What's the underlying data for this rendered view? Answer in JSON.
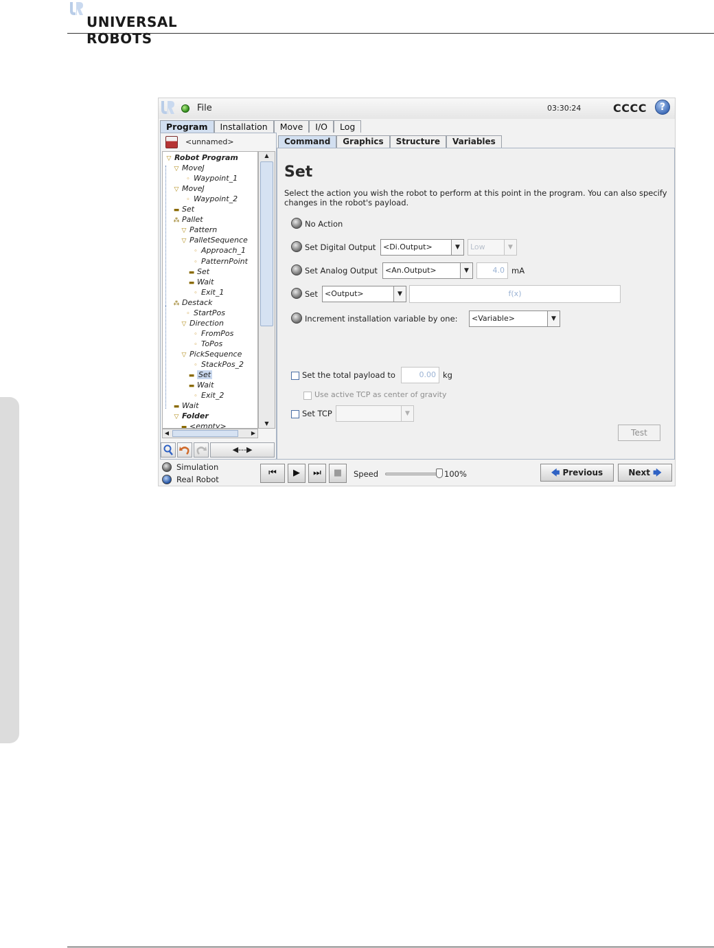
{
  "page": {
    "brand": "UNIVERSAL ROBOTS"
  },
  "titlebar": {
    "file_label": "File",
    "clock": "03:30:24",
    "robot_name": "CCCC",
    "help_glyph": "?"
  },
  "main_tabs": [
    "Program",
    "Installation",
    "Move",
    "I/O",
    "Log"
  ],
  "program": {
    "name": "<unnamed>",
    "tree": [
      {
        "label": "Robot Program",
        "depth": 0,
        "icon": "triangle",
        "bold": true
      },
      {
        "label": "MoveJ",
        "depth": 1,
        "icon": "triangle"
      },
      {
        "label": "Waypoint_1",
        "depth": 2,
        "icon": "waypoint"
      },
      {
        "label": "MoveJ",
        "depth": 1,
        "icon": "triangle"
      },
      {
        "label": "Waypoint_2",
        "depth": 2,
        "icon": "waypoint"
      },
      {
        "label": "Set",
        "depth": 1,
        "icon": "bar"
      },
      {
        "label": "Pallet",
        "depth": 1,
        "icon": "pallet"
      },
      {
        "label": "Pattern",
        "depth": 2,
        "icon": "triangle"
      },
      {
        "label": "PalletSequence",
        "depth": 2,
        "icon": "triangle"
      },
      {
        "label": "Approach_1",
        "depth": 3,
        "icon": "waypoint"
      },
      {
        "label": "PatternPoint",
        "depth": 3,
        "icon": "waypoint"
      },
      {
        "label": "Set",
        "depth": 3,
        "icon": "bar"
      },
      {
        "label": "Wait",
        "depth": 3,
        "icon": "bar"
      },
      {
        "label": "Exit_1",
        "depth": 3,
        "icon": "waypoint"
      },
      {
        "label": "Destack",
        "depth": 1,
        "icon": "pallet"
      },
      {
        "label": "StartPos",
        "depth": 2,
        "icon": "waypoint"
      },
      {
        "label": "Direction",
        "depth": 2,
        "icon": "triangle"
      },
      {
        "label": "FromPos",
        "depth": 3,
        "icon": "waypoint"
      },
      {
        "label": "ToPos",
        "depth": 3,
        "icon": "waypoint"
      },
      {
        "label": "PickSequence",
        "depth": 2,
        "icon": "triangle"
      },
      {
        "label": "StackPos_2",
        "depth": 3,
        "icon": "waypoint"
      },
      {
        "label": "Set",
        "depth": 3,
        "icon": "bar",
        "selected": true
      },
      {
        "label": "Wait",
        "depth": 3,
        "icon": "bar"
      },
      {
        "label": "Exit_2",
        "depth": 3,
        "icon": "waypoint"
      },
      {
        "label": "Wait",
        "depth": 1,
        "icon": "bar"
      },
      {
        "label": "Folder",
        "depth": 1,
        "icon": "triangle",
        "bold": true
      },
      {
        "label": "<empty>",
        "depth": 2,
        "icon": "bar"
      }
    ],
    "tools": {
      "search": "search-icon",
      "undo": "undo-icon",
      "redo": "redo-icon",
      "move_label": "◀---▶"
    }
  },
  "sub_tabs": [
    "Command",
    "Graphics",
    "Structure",
    "Variables"
  ],
  "command": {
    "title": "Set",
    "description": "Select the action you wish the robot to perform at this point in the program. You can also specify changes in the robot's payload.",
    "no_action": "No Action",
    "digital_output_label": "Set Digital Output",
    "digital_output_value": "<Di.Output>",
    "digital_level_value": "Low",
    "analog_output_label": "Set Analog Output",
    "analog_output_value": "<An.Output>",
    "analog_value": "4.0",
    "analog_unit": "mA",
    "set_label": "Set",
    "set_output_value": "<Output>",
    "expression_placeholder": "f(x)",
    "increment_label": "Increment installation variable by one:",
    "variable_value": "<Variable>",
    "payload_label": "Set the total payload to",
    "payload_value": "0.00",
    "payload_unit": "kg",
    "cog_label": "Use active TCP as center of gravity",
    "tcp_label": "Set TCP",
    "test_label": "Test"
  },
  "bottom": {
    "simulation_label": "Simulation",
    "real_robot_label": "Real Robot",
    "speed_label": "Speed",
    "speed_value": "100%",
    "speed_fraction": 1.0,
    "previous_label": "Previous",
    "next_label": "Next"
  },
  "colors": {
    "active_tab": "#d2dff0",
    "accent_blue": "#2f62c4",
    "tree_icon": "#b08b16"
  }
}
